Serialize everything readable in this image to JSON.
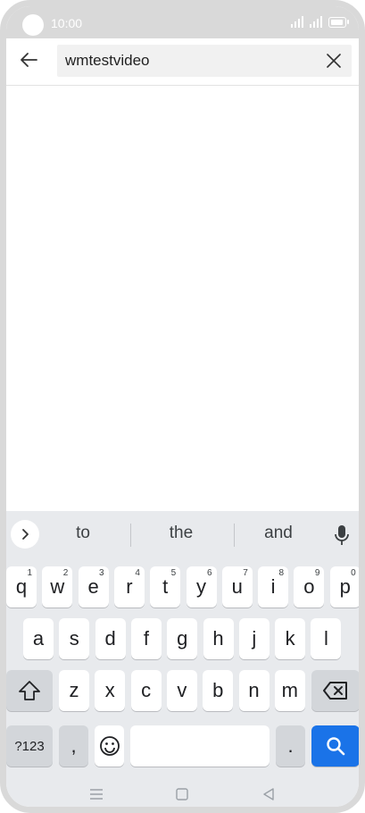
{
  "status_bar": {
    "time": "10:00"
  },
  "search": {
    "query": "wmtestvideo"
  },
  "keyboard": {
    "suggestions": [
      "to",
      "the",
      "and"
    ],
    "row1": [
      {
        "key": "q",
        "hint": "1"
      },
      {
        "key": "w",
        "hint": "2"
      },
      {
        "key": "e",
        "hint": "3"
      },
      {
        "key": "r",
        "hint": "4"
      },
      {
        "key": "t",
        "hint": "5"
      },
      {
        "key": "y",
        "hint": "6"
      },
      {
        "key": "u",
        "hint": "7"
      },
      {
        "key": "i",
        "hint": "8"
      },
      {
        "key": "o",
        "hint": "9"
      },
      {
        "key": "p",
        "hint": "0"
      }
    ],
    "row2": [
      "a",
      "s",
      "d",
      "f",
      "g",
      "h",
      "j",
      "k",
      "l"
    ],
    "row3": [
      "z",
      "x",
      "c",
      "v",
      "b",
      "n",
      "m"
    ],
    "symbols_label": "?123",
    "comma_label": ",",
    "period_label": ".",
    "icons": {
      "expand": "chevron-right-icon",
      "mic": "microphone-icon",
      "shift": "shift-icon",
      "backspace": "backspace-icon",
      "emoji": "emoji-icon",
      "search": "search-icon"
    },
    "colors": {
      "action_key": "#1a73e8",
      "keyboard_bg": "#e8eaed"
    }
  }
}
